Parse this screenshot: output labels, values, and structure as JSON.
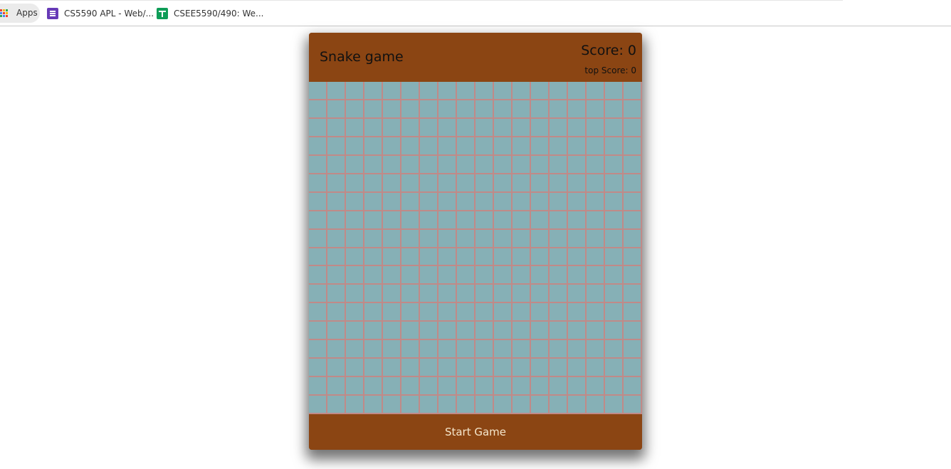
{
  "bookmarks": [
    {
      "label": "Apps",
      "icon": "apps-grid-icon"
    },
    {
      "label": "CS5590 APL - Web/...",
      "icon": "google-forms-icon"
    },
    {
      "label": "CSEE5590/490: We...",
      "icon": "google-sheets-icon"
    }
  ],
  "game": {
    "title": "Snake game",
    "score_text": "Score: 0",
    "top_score_text": "top Score: 0",
    "start_label": "Start Game",
    "grid": {
      "cols": 18,
      "rows": 18
    }
  },
  "colors": {
    "panel": "#8b4513",
    "board": "#86b0b6",
    "grid_lines": "#c08a88",
    "button_text": "#f5e6cc"
  }
}
